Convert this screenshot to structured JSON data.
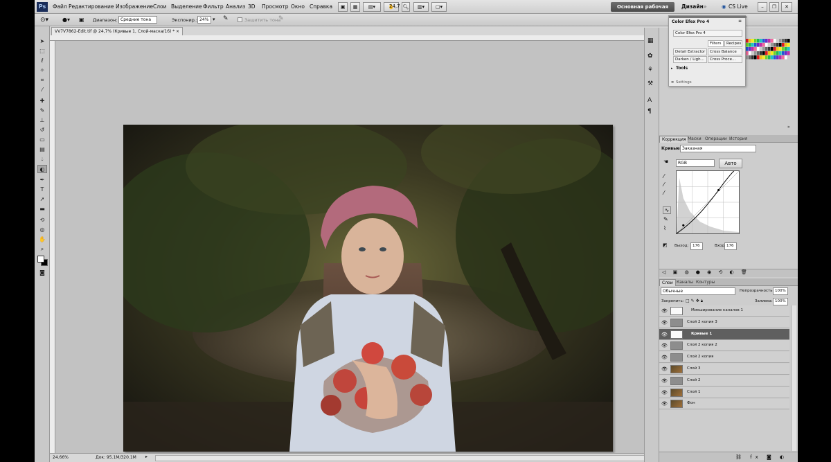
{
  "menubar": {
    "logo": "Ps",
    "items": [
      "Файл",
      "Редактирование",
      "Изображение",
      "Слои",
      "Выделение",
      "Фильтр",
      "Анализ",
      "3D",
      "Просмотр",
      "Окно",
      "Справка"
    ],
    "zoom_value": "24,7",
    "workspace_active": "Основная рабочая среда",
    "workspace_design": "Дизайн",
    "cs_live": "CS Live"
  },
  "options": {
    "range_label": "Диапазон:",
    "range_value": "Средние тона",
    "exposure_label": "Экспонир.:",
    "exposure_value": "24%",
    "protect_tones": "Защитить тона"
  },
  "document": {
    "tab_title": "VV7V7862-Edit.tif @ 24,7% (Кривые 1, Слой-маска/16) *",
    "zoom_status": "24.66%",
    "doc_info": "Док: 95.1M/320.1M"
  },
  "color_efex": {
    "title": "Color Efex Pro 4",
    "preset": "Color Efex Pro 4",
    "tab_filters": "Filters",
    "tab_recipes": "Recipes",
    "buttons": [
      "Detail Extractor",
      "Cross Balance",
      "Darken / Ligh...",
      "Cross Proce..."
    ],
    "tools": "Tools",
    "settings": "Settings"
  },
  "adjustments": {
    "tabs": [
      "Коррекция",
      "Маски",
      "Операции",
      "История"
    ],
    "curves_label": "Кривые",
    "preset_value": "Заказная",
    "channel": "RGB",
    "auto_button": "Авто",
    "output_label": "Выход:",
    "output_value": "176",
    "input_label": "Вход:",
    "input_value": "176"
  },
  "layers": {
    "tabs": [
      "Слои",
      "Каналы",
      "Контуры"
    ],
    "blend_mode": "Обычные",
    "opacity_label": "Непрозрачность:",
    "opacity_value": "100%",
    "lock_label": "Закрепить:",
    "fill_label": "Заливка:",
    "fill_value": "100%",
    "rows": [
      {
        "name": "Микширование каналов 1",
        "type": "adjustment",
        "selected": false
      },
      {
        "name": "Слой 2 копия 3",
        "type": "gray",
        "selected": false
      },
      {
        "name": "Кривые 1",
        "type": "adjustment",
        "selected": true
      },
      {
        "name": "Слой 2 копия 2",
        "type": "gray",
        "selected": false
      },
      {
        "name": "Слой 2 копия",
        "type": "gray",
        "selected": false
      },
      {
        "name": "Слой 3",
        "type": "photo",
        "selected": false
      },
      {
        "name": "Слой 2",
        "type": "gray",
        "selected": false
      },
      {
        "name": "Слой 1",
        "type": "photo",
        "selected": false
      },
      {
        "name": "Фон",
        "type": "photo",
        "selected": false
      }
    ]
  },
  "colors": {
    "workspace_button": "#555555",
    "selected_layer": "#5f5f5f",
    "ps_logo_bg": "#1a2d5a"
  }
}
